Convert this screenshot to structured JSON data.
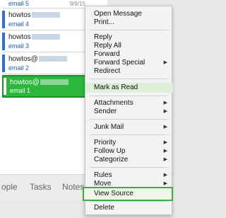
{
  "messages": [
    {
      "sender": "",
      "subject": "email 5",
      "date": "9/9/15",
      "selected": false
    },
    {
      "sender": "howtos",
      "subject": "email 4",
      "selected": false
    },
    {
      "sender": "howtos",
      "subject": "email 3",
      "selected": false
    },
    {
      "sender": "howtos@",
      "subject": "email 2",
      "selected": false
    },
    {
      "sender": "howtos@",
      "subject": "email 1",
      "selected": true
    }
  ],
  "nav": {
    "people": "ople",
    "tasks": "Tasks",
    "notes": "Notes"
  },
  "menu": {
    "open_message": "Open Message",
    "print": "Print...",
    "reply": "Reply",
    "reply_all": "Reply All",
    "forward": "Forward",
    "forward_special": "Forward Special",
    "redirect": "Redirect",
    "mark_as_read": "Mark as Read",
    "attachments": "Attachments",
    "sender": "Sender",
    "junk_mail": "Junk Mail",
    "priority": "Priority",
    "follow_up": "Follow Up",
    "categorize": "Categorize",
    "rules": "Rules",
    "move": "Move",
    "view_source": "View Source",
    "delete": "Delete",
    "submenu_arrow": "▶"
  },
  "colors": {
    "selected_row": "#2bb83b",
    "accent_blue": "#2f6fcf",
    "highlight_green": "#3cae3c"
  }
}
